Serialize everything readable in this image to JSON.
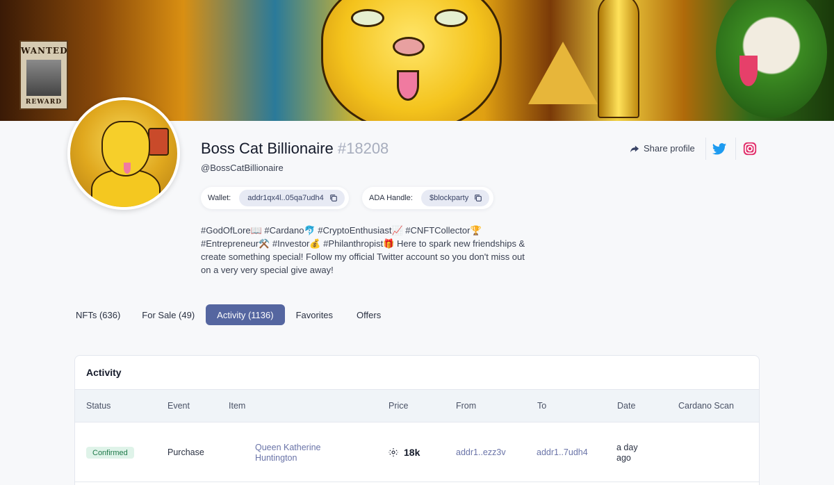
{
  "banner": {
    "wanted_text": "WANTED",
    "reward_text": "REWARD"
  },
  "profile": {
    "name": "Boss Cat Billionaire",
    "number": "#18208",
    "handle": "@BossCatBillionaire",
    "wallet_label": "Wallet:",
    "wallet_value": "addr1qx4l..05qa7udh4",
    "ada_handle_label": "ADA Handle:",
    "ada_handle_value": "$blockparty",
    "bio": "#GodOfLore📖 #Cardano🐬 #CryptoEnthusiast📈 #CNFTCollector🏆 #Entrepreneur⚒️ #Investor💰 #Philanthropist🎁 Here to spark new friendships & create something special! Follow my official Twitter account so you don't miss out on a very very special give away!"
  },
  "actions": {
    "share_label": "Share profile",
    "share_icon": "share-arrow-icon",
    "twitter_icon": "twitter-icon",
    "instagram_icon": "instagram-icon"
  },
  "tabs": [
    {
      "label": "NFTs (636)",
      "active": false
    },
    {
      "label": "For Sale (49)",
      "active": false
    },
    {
      "label": "Activity (1136)",
      "active": true
    },
    {
      "label": "Favorites",
      "active": false
    },
    {
      "label": "Offers",
      "active": false
    }
  ],
  "activity": {
    "title": "Activity",
    "columns": [
      "Status",
      "Event",
      "Item",
      "Price",
      "From",
      "To",
      "Date",
      "Cardano Scan"
    ],
    "rows": [
      {
        "status": "Confirmed",
        "event": "Purchase",
        "item": "Queen Katherine Huntington",
        "price": "18k",
        "from": "addr1..ezz3v",
        "to": "addr1..7udh4",
        "date": "a day ago",
        "cardano_scan": ""
      }
    ]
  },
  "colors": {
    "accent": "#5566a0",
    "confirmed_bg": "#dff3e9",
    "confirmed_text": "#1f7a4a",
    "twitter": "#1d9bf0",
    "instagram": "#e1306c"
  }
}
